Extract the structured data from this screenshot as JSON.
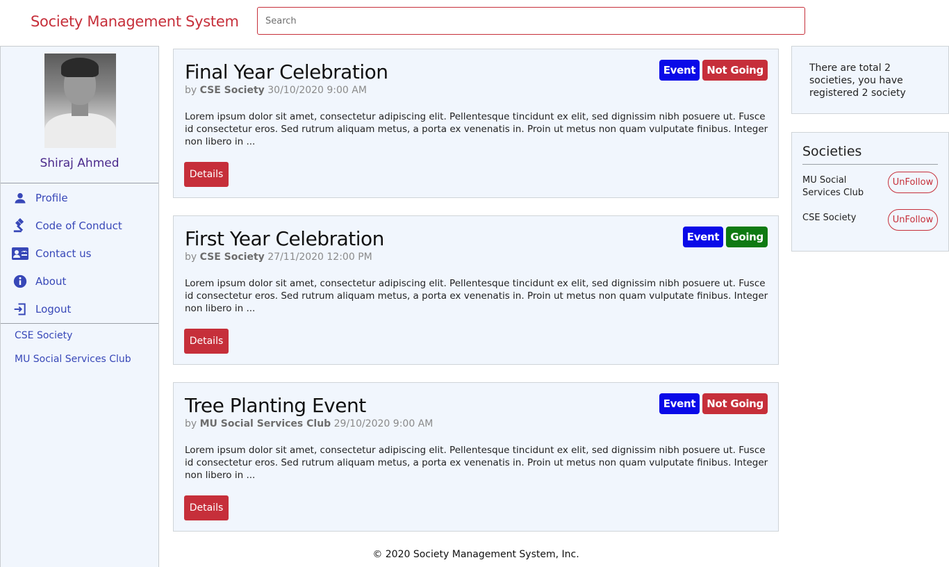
{
  "header": {
    "brand": "Society Management System",
    "search_placeholder": "Search"
  },
  "user": {
    "name": "Shiraj Ahmed"
  },
  "nav": [
    {
      "label": "Profile",
      "icon": "person-icon"
    },
    {
      "label": "Code of Conduct",
      "icon": "gavel-icon"
    },
    {
      "label": "Contact us",
      "icon": "contact-card-icon"
    },
    {
      "label": "About",
      "icon": "info-icon"
    },
    {
      "label": "Logout",
      "icon": "logout-icon"
    }
  ],
  "sidebar_societies": [
    "CSE Society",
    "MU Social Services Club"
  ],
  "events": [
    {
      "title": "Final Year Celebration",
      "by": "by",
      "org": "CSE Society",
      "datetime": "30/10/2020 9:00 AM",
      "body": "Lorem ipsum dolor sit amet, consectetur adipiscing elit. Pellentesque tincidunt ex elit, sed dignissim nibh posuere ut. Fusce id consectetur eros. Sed rutrum aliquam metus, a porta ex venenatis in. Proin ut metus non quam vulputate finibus. Integer non libero in ...",
      "type_badge": "Event",
      "status_badge": "Not Going",
      "status_color": "#c62f3a",
      "details_label": "Details"
    },
    {
      "title": "First Year Celebration",
      "by": "by",
      "org": "CSE Society",
      "datetime": "27/11/2020 12:00 PM",
      "body": "Lorem ipsum dolor sit amet, consectetur adipiscing elit. Pellentesque tincidunt ex elit, sed dignissim nibh posuere ut. Fusce id consectetur eros. Sed rutrum aliquam metus, a porta ex venenatis in. Proin ut metus non quam vulputate finibus. Integer non libero in ...",
      "type_badge": "Event",
      "status_badge": "Going",
      "status_color": "#0f7a12",
      "details_label": "Details"
    },
    {
      "title": "Tree Planting Event",
      "by": "by",
      "org": "MU Social Services Club",
      "datetime": "29/10/2020 9:00 AM",
      "body": "Lorem ipsum dolor sit amet, consectetur adipiscing elit. Pellentesque tincidunt ex elit, sed dignissim nibh posuere ut. Fusce id consectetur eros. Sed rutrum aliquam metus, a porta ex venenatis in. Proin ut metus non quam vulputate finibus. Integer non libero in ...",
      "type_badge": "Event",
      "status_badge": "Not Going",
      "status_color": "#c62f3a",
      "details_label": "Details"
    }
  ],
  "info_text": "There are total 2 societies, you have registered 2 society",
  "societies_panel": {
    "heading": "Societies",
    "items": [
      {
        "name": "MU Social Services Club",
        "button": "UnFollow"
      },
      {
        "name": "CSE Society",
        "button": "UnFollow"
      }
    ]
  },
  "footer": "© 2020 Society Management System, Inc.",
  "colors": {
    "brand": "#c62f3a",
    "event_badge": "#0a0ae8",
    "nav_link": "#3848b8",
    "panel_bg": "#f1f6fd"
  }
}
